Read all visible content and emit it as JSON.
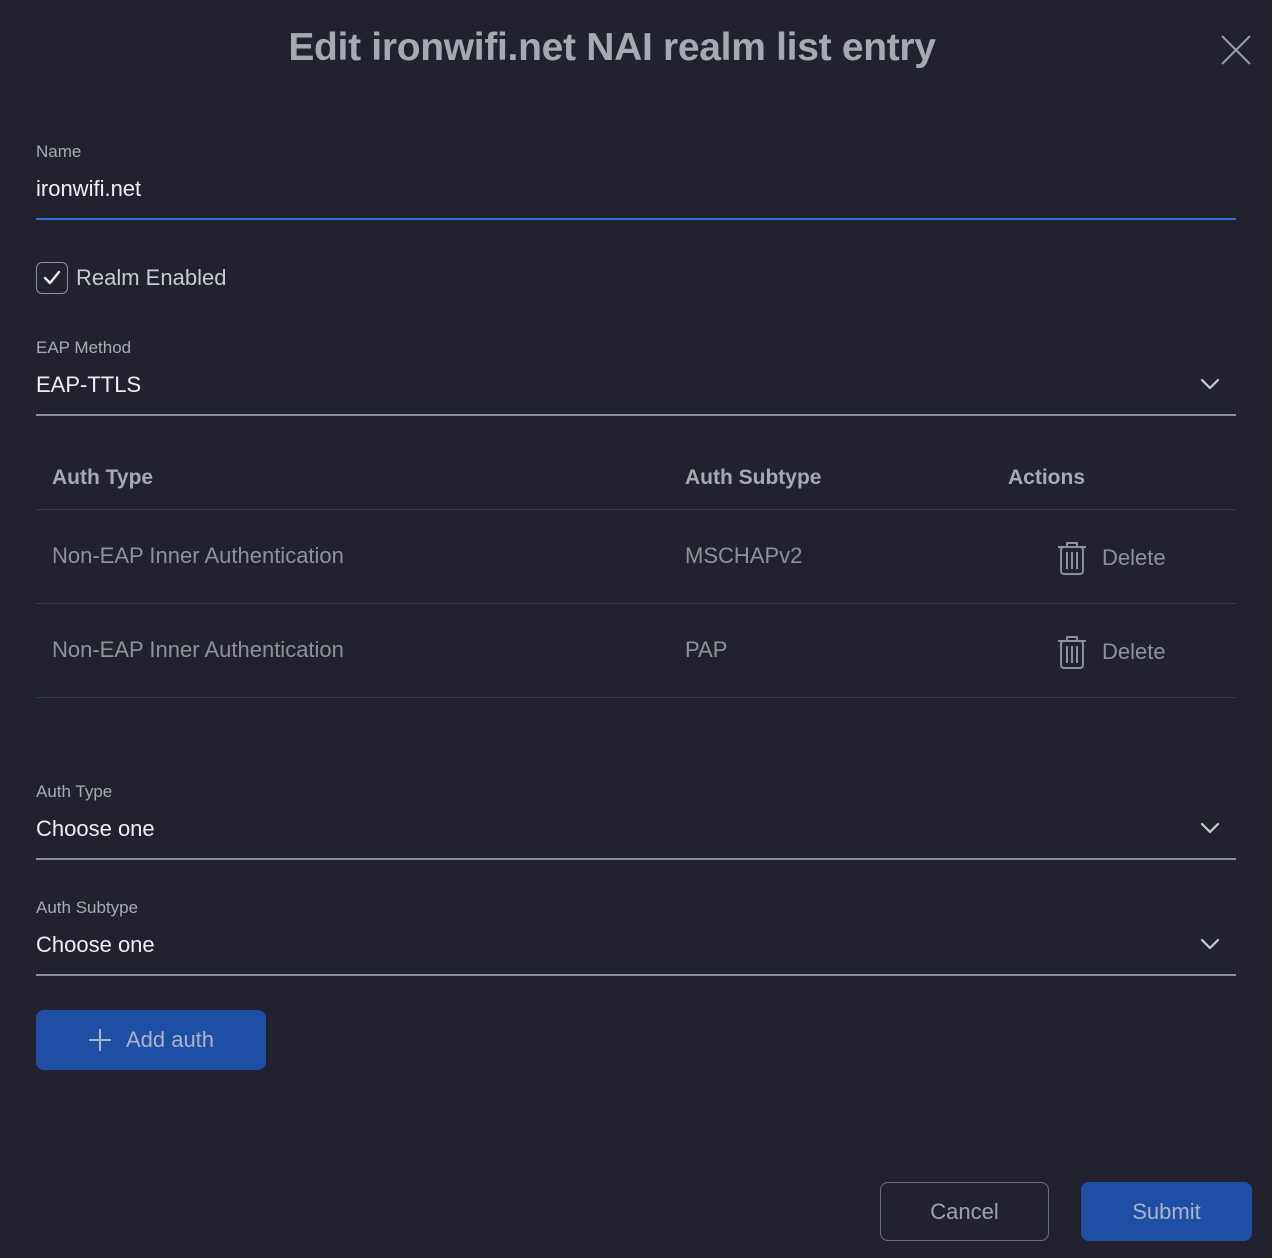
{
  "dialog": {
    "title": "Edit ironwifi.net NAI realm list entry"
  },
  "form": {
    "name": {
      "label": "Name",
      "value": "ironwifi.net"
    },
    "realm_enabled": {
      "label": "Realm Enabled",
      "checked": true
    },
    "eap_method": {
      "label": "EAP Method",
      "value": "EAP-TTLS"
    },
    "auth_type": {
      "label": "Auth Type",
      "value": "Choose one"
    },
    "auth_subtype": {
      "label": "Auth Subtype",
      "value": "Choose one"
    },
    "add_auth_label": "Add auth"
  },
  "table": {
    "headers": [
      "Auth Type",
      "Auth Subtype",
      "Actions"
    ],
    "rows": [
      {
        "auth_type": "Non-EAP Inner Authentication",
        "auth_subtype": "MSCHAPv2",
        "action": "Delete"
      },
      {
        "auth_type": "Non-EAP Inner Authentication",
        "auth_subtype": "PAP",
        "action": "Delete"
      }
    ]
  },
  "footer": {
    "cancel_label": "Cancel",
    "submit_label": "Submit"
  },
  "icons": {
    "close": "close-icon",
    "check": "check-icon",
    "chevron": "chevron-down-icon",
    "trash": "trash-icon",
    "plus": "plus-icon"
  },
  "colors": {
    "background": "#21222d",
    "accent": "#2f6fd8",
    "primary_button": "#1f4fa5"
  }
}
